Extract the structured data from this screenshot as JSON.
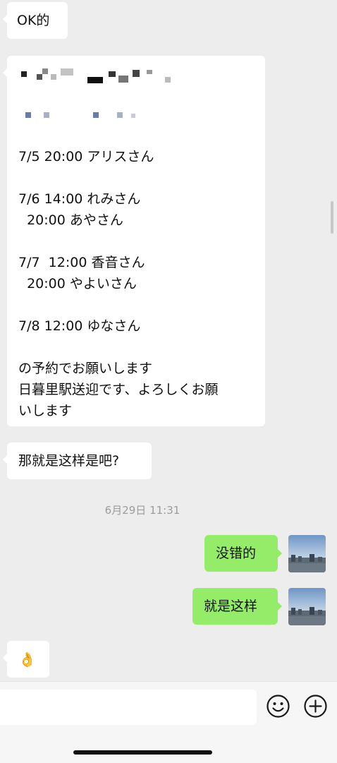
{
  "messages": {
    "ok": "OK的",
    "schedule_lines": [
      "7/5 20:00 アリスさん",
      "",
      "7/6 14:00 れみさん",
      "  20:00 あやさん",
      "",
      "7/7  12:00 香音さん",
      "  20:00 やよいさん",
      "",
      "7/8 12:00 ゆなさん",
      "",
      "の予約でお願いします",
      "日暮里駅送迎です、よろしくお願",
      "いします"
    ],
    "confirm_question": "那就是这样是吧?",
    "timestamp": "6月29日 11:31",
    "reply1": "没错的",
    "reply2": "就是这样",
    "emoji": "👌"
  },
  "input": {
    "placeholder": ""
  },
  "icons": {
    "emoji_button": "smiley-icon",
    "more_button": "plus-icon"
  },
  "colors": {
    "background": "#ededed",
    "sent_bubble": "#95ec69",
    "received_bubble": "#ffffff",
    "timestamp": "#9c9c9c"
  }
}
